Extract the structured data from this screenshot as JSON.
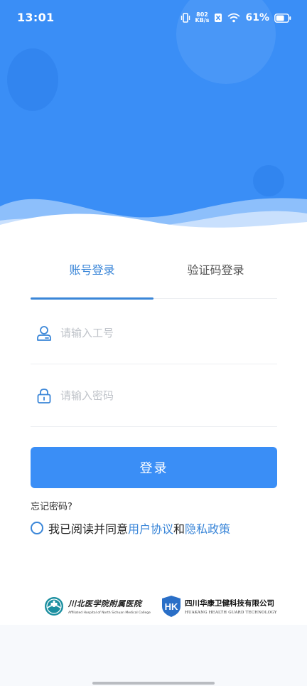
{
  "status": {
    "time": "13:01",
    "net_speed_value": "802",
    "net_speed_unit": "KB/s",
    "battery": "61%"
  },
  "tabs": [
    {
      "label": "账号登录",
      "active": true
    },
    {
      "label": "验证码登录",
      "active": false
    }
  ],
  "form": {
    "username_placeholder": "请输入工号",
    "password_placeholder": "请输入密码",
    "login_label": "登录",
    "forgot_label": "忘记密码?"
  },
  "agreement": {
    "prefix": "我已阅读并同意",
    "user_agreement": "用户协议",
    "and": "和",
    "privacy_policy": "隐私政策"
  },
  "logos": {
    "hospital_cn": "川北医学院附属医院",
    "hospital_en": "Affiliated Hospital of North Sichuan Medical College",
    "company_cn": "四川华康卫健科技有限公司",
    "company_en": "HUAKANG HEALTH GUARD TECHNOLOGY",
    "company_mark": "HK"
  },
  "colors": {
    "primary": "#3a8ef6",
    "link": "#3a86d8"
  }
}
